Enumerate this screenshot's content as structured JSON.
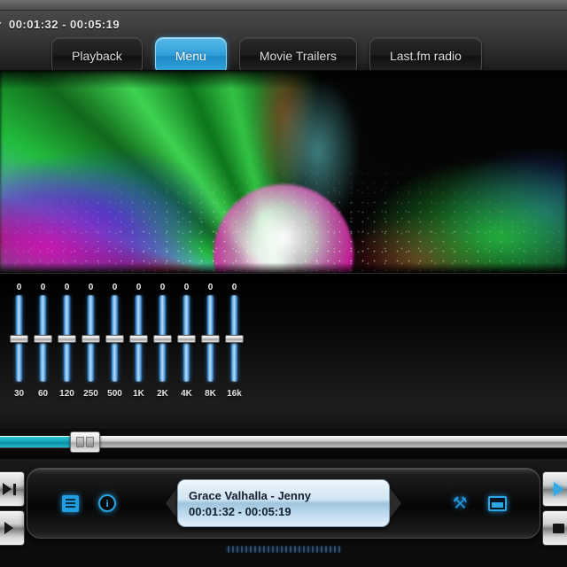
{
  "window": {
    "session_label": "y",
    "session_time": "00:01:32 - 00:05:19"
  },
  "toolbar": {
    "tabs": [
      {
        "label": "Playback",
        "active": false
      },
      {
        "label": "Menu",
        "active": true
      },
      {
        "label": "Movie Trailers",
        "active": false
      },
      {
        "label": "Last.fm radio",
        "active": false
      }
    ]
  },
  "visualizer": {
    "name": "particle-burst-visualization"
  },
  "equalizer": {
    "bands": [
      {
        "label": "30",
        "value": "0"
      },
      {
        "label": "60",
        "value": "0"
      },
      {
        "label": "120",
        "value": "0"
      },
      {
        "label": "250",
        "value": "0"
      },
      {
        "label": "500",
        "value": "0"
      },
      {
        "label": "1K",
        "value": "0"
      },
      {
        "label": "2K",
        "value": "0"
      },
      {
        "label": "4K",
        "value": "0"
      },
      {
        "label": "8K",
        "value": "0"
      },
      {
        "label": "16k",
        "value": "0"
      }
    ]
  },
  "seek": {
    "progress_percent": 15,
    "fill_color": "#12a8bd"
  },
  "transport": {
    "left_buttons": [
      {
        "name": "next-track-button"
      },
      {
        "name": "previous-track-button"
      }
    ],
    "right_buttons": [
      {
        "name": "play-button"
      },
      {
        "name": "stop-button"
      }
    ],
    "left_icons": [
      {
        "name": "playlist-icon",
        "glyph": ""
      },
      {
        "name": "info-icon",
        "glyph": "i"
      }
    ],
    "right_icons": [
      {
        "name": "tools-icon",
        "glyph": "⚒"
      },
      {
        "name": "fullscreen-icon",
        "glyph": ""
      }
    ],
    "display": {
      "title": "Grace Valhalla - Jenny",
      "time": "00:01:32 - 00:05:19"
    }
  },
  "colors": {
    "accent_blue": "#2fa0da",
    "lcd_blue": "#cfe4f2",
    "seek_cyan": "#12a8bd"
  }
}
